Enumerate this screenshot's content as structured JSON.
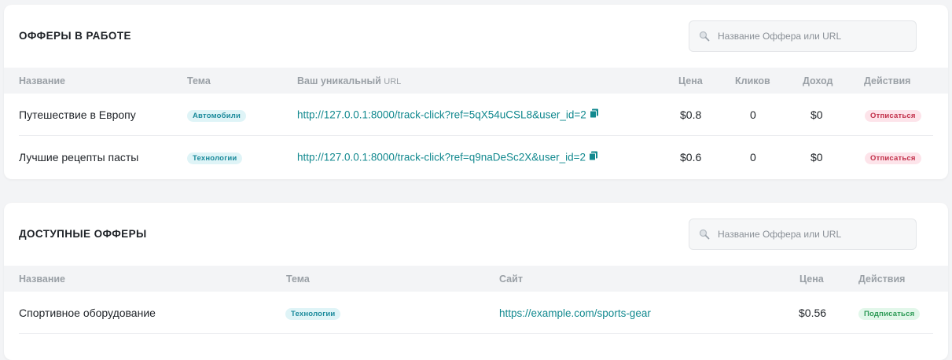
{
  "colors": {
    "link": "#12898f",
    "badge_topic_bg": "#dff4f7",
    "badge_topic_fg": "#1b8a9b",
    "unsubscribe_bg": "#fde4ea",
    "unsubscribe_fg": "#c2304a",
    "subscribe_bg": "#e2f7ea",
    "subscribe_fg": "#2c9a55"
  },
  "active": {
    "title": "ОФФЕРЫ В РАБОТЕ",
    "search_placeholder": "Название Оффера или URL",
    "columns": {
      "name": "Название",
      "topic": "Тема",
      "url_bold": "Ваш уникальный",
      "url_light": "URL",
      "price": "Цена",
      "clicks": "Кликов",
      "income": "Доход",
      "actions": "Действия"
    },
    "rows": [
      {
        "name": "Путешествие в Европу",
        "topic": "Автомобили",
        "url": "http://127.0.0.1:8000/track-click?ref=5qX54uCSL8&user_id=2",
        "price": "$0.8",
        "clicks": "0",
        "income": "$0",
        "action": "Отписаться"
      },
      {
        "name": "Лучшие рецепты пасты",
        "topic": "Технологии",
        "url": "http://127.0.0.1:8000/track-click?ref=q9naDeSc2X&user_id=2",
        "price": "$0.6",
        "clicks": "0",
        "income": "$0",
        "action": "Отписаться"
      }
    ]
  },
  "available": {
    "title": "ДОСТУПНЫЕ ОФФЕРЫ",
    "search_placeholder": "Название Оффера или URL",
    "columns": {
      "name": "Название",
      "topic": "Тема",
      "site": "Сайт",
      "price": "Цена",
      "actions": "Действия"
    },
    "rows": [
      {
        "name": "Спортивное оборудование",
        "topic": "Технологии",
        "site": "https://example.com/sports-gear",
        "price": "$0.56",
        "action": "Подписаться"
      }
    ]
  }
}
